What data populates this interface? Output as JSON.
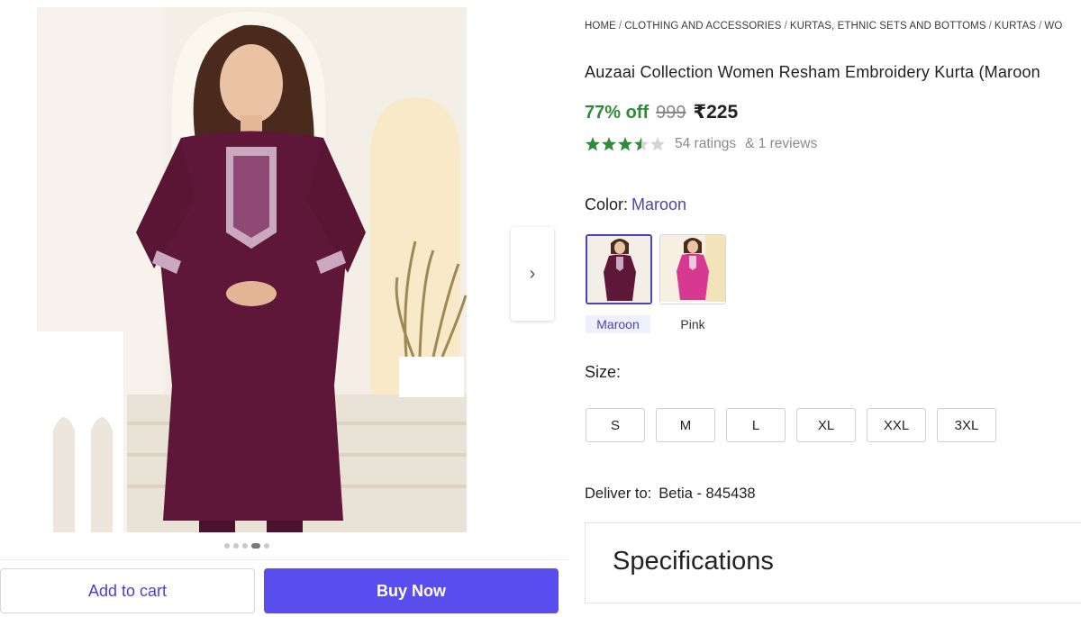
{
  "breadcrumb": [
    "HOME",
    "CLOTHING AND ACCESSORIES",
    "KURTAS, ETHNIC SETS AND BOTTOMS",
    "KURTAS",
    "WO"
  ],
  "product": {
    "title": "Auzaai Collection Women Resham Embroidery Kurta (Maroon",
    "discount": "77% off",
    "mrp": "999",
    "price": "₹225",
    "rating_value": 3.5,
    "ratings_text": "54 ratings",
    "reviews_text": "& 1 reviews"
  },
  "color": {
    "label": "Color:",
    "selected": "Maroon",
    "options": [
      "Maroon",
      "Pink"
    ]
  },
  "size": {
    "label": "Size:",
    "options": [
      "S",
      "M",
      "L",
      "XL",
      "XXL",
      "3XL"
    ]
  },
  "delivery": {
    "label": "Deliver to:",
    "location": "Betia - 845438"
  },
  "specifications": {
    "title": "Specifications"
  },
  "actions": {
    "add_to_cart": "Add to cart",
    "buy_now": "Buy Now"
  },
  "gallery": {
    "image_count": 5,
    "active_index": 3
  },
  "colors": {
    "accent": "#5a4ded",
    "discount_green": "#2e8b3a",
    "star_green": "#2e8b3a",
    "kurta_maroon": "#5e1738",
    "kurta_pink": "#d6398f"
  },
  "icons": {
    "next": "chevron-right-icon",
    "star": "star-icon"
  }
}
